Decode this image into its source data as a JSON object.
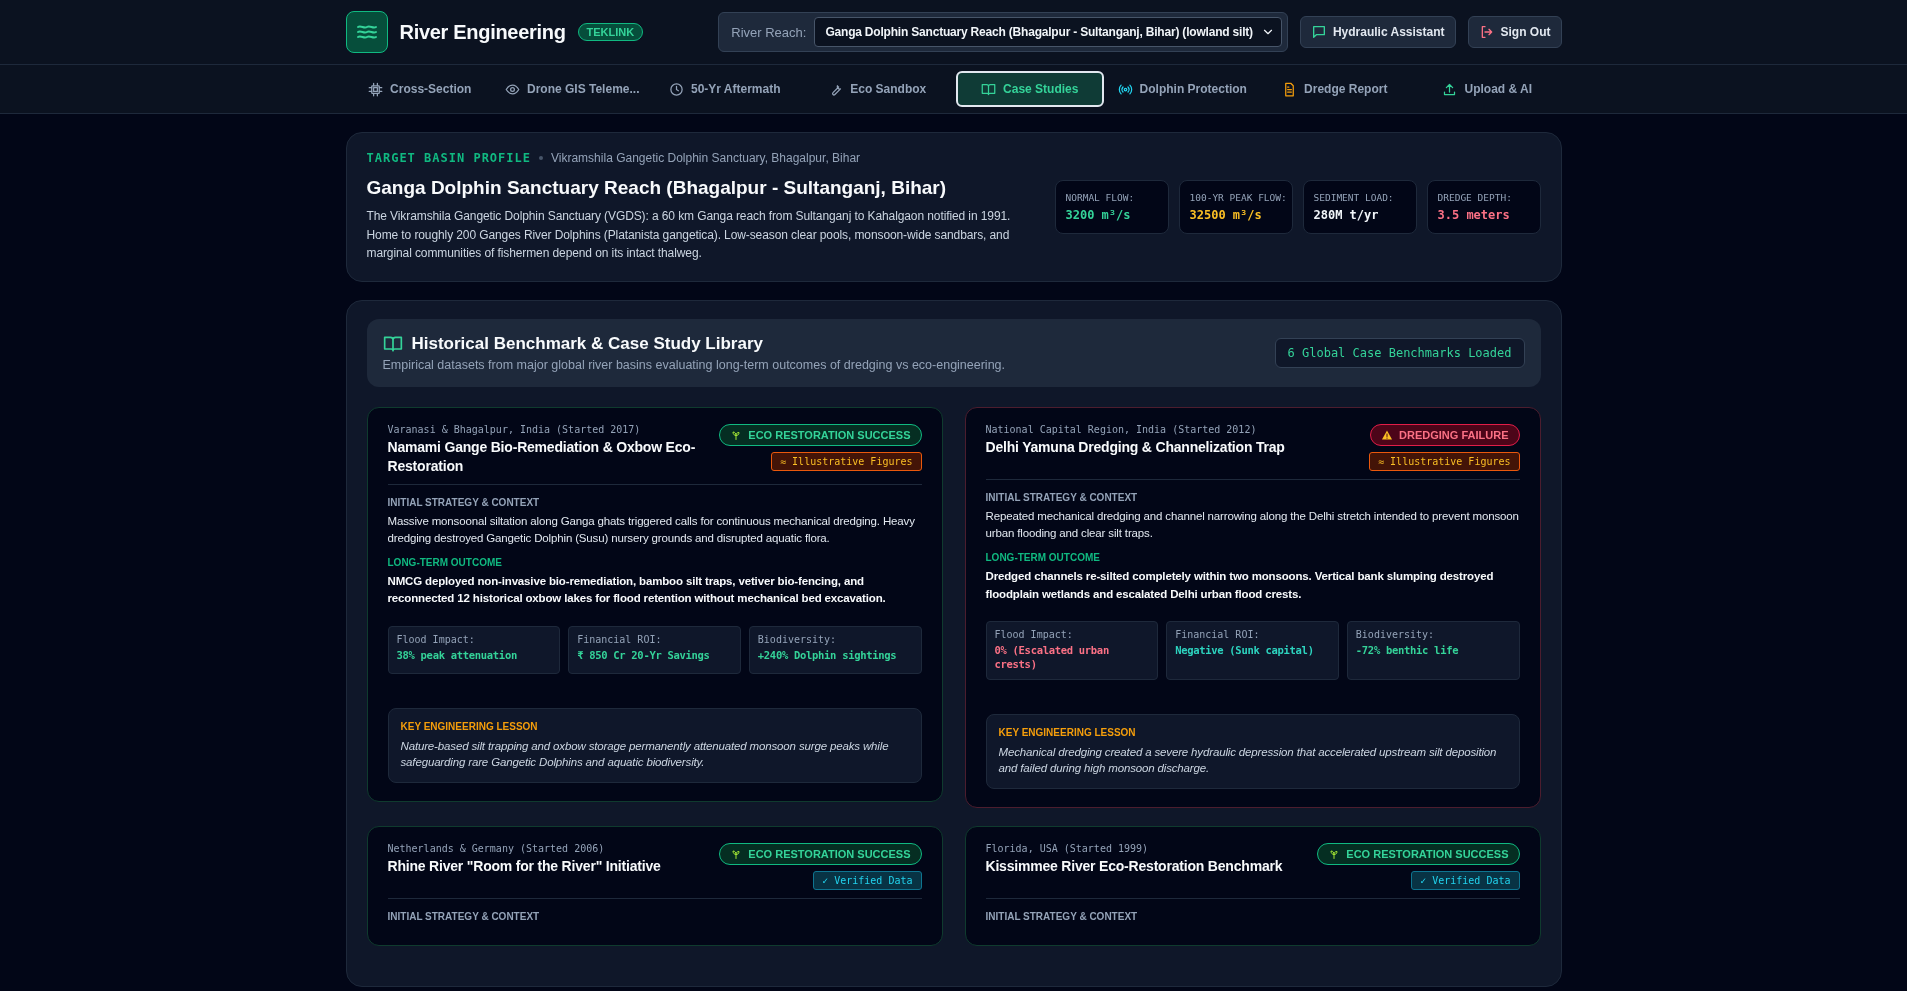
{
  "header": {
    "title": "River Engineering",
    "badge": "TEKLINK",
    "reach_label": "River Reach:",
    "reach_value": "Ganga Dolphin Sanctuary Reach (Bhagalpur - Sultanganj, Bihar) (lowland silt)",
    "buttons": [
      {
        "kind": "assistant",
        "label": "Hydraulic Assistant"
      },
      {
        "kind": "signout",
        "label": "Sign Out"
      }
    ]
  },
  "tabs": [
    {
      "label": "Cross-Section",
      "selected": false
    },
    {
      "label": "Drone GIS Teleme...",
      "selected": false
    },
    {
      "label": "50-Yr Aftermath",
      "selected": false
    },
    {
      "label": "Eco Sandbox",
      "selected": false
    },
    {
      "label": "Case Studies",
      "selected": true
    },
    {
      "label": "Dolphin Protection",
      "selected": false
    },
    {
      "label": "Dredge Report",
      "selected": false
    },
    {
      "label": "Upload & AI",
      "selected": false
    }
  ],
  "basin_profile": {
    "eyebrow": "TARGET BASIN PROFILE",
    "location": "Vikramshila Gangetic Dolphin Sanctuary, Bhagalpur, Bihar",
    "title": "Ganga Dolphin Sanctuary Reach (Bhagalpur - Sultanganj, Bihar)",
    "description": "The Vikramshila Gangetic Dolphin Sanctuary (VGDS): a 60 km Ganga reach from Sultanganj to Kahalgaon notified in 1991. Home to roughly 200 Ganges River Dolphins (Platanista gangetica). Low-season clear pools, monsoon-wide sandbars, and marginal communities of fishermen depend on its intact thalweg.",
    "stats": [
      {
        "label": "NORMAL FLOW:",
        "value": "3200 m³/s",
        "color": "#34d399"
      },
      {
        "label": "100-YR PEAK FLOW:",
        "value": "32500 m³/s",
        "color": "#fbbf24"
      },
      {
        "label": "SEDIMENT LOAD:",
        "value": "280M t/yr",
        "color": "#f1f5f9"
      },
      {
        "label": "DREDGE DEPTH:",
        "value": "3.5 meters",
        "color": "#fb7185"
      }
    ]
  },
  "library": {
    "title": "Historical Benchmark & Case Study Library",
    "subtitle": "Empirical datasets from major global river basins evaluating long-term outcomes of dredging vs eco-engineering.",
    "count_badge": "6 Global Case Benchmarks Loaded",
    "cases": [
      {
        "kind": "success",
        "location": "Varanasi & Bhagalpur, India (Started 2017)",
        "title": "Namami Gange Bio-Remediation & Oxbow Eco-Restoration",
        "status": "ECO RESTORATION SUCCESS",
        "figures": {
          "kind": "illustrative",
          "label": "≈ Illustrative Figures"
        },
        "strategy_label": "INITIAL STRATEGY & CONTEXT",
        "strategy": "Massive monsoonal siltation along Ganga ghats triggered calls for continuous mechanical dredging. Heavy dredging destroyed Gangetic Dolphin (Susu) nursery grounds and disrupted aquatic flora.",
        "outcome_label": "LONG-TERM OUTCOME",
        "outcome": "NMCG deployed non-invasive bio-remediation, bamboo silt traps, vetiver bio-fencing, and reconnected 12 historical oxbow lakes for flood retention without mechanical bed excavation.",
        "metrics": [
          {
            "label": "Flood Impact:",
            "value": "38% peak attenuation",
            "color": "#34d399"
          },
          {
            "label": "Financial ROI:",
            "value": "₹ 850 Cr 20-Yr Savings",
            "color": "#34d399"
          },
          {
            "label": "Biodiversity:",
            "value": "+240% Dolphin sightings",
            "color": "#34d399"
          }
        ],
        "lesson_label": "KEY ENGINEERING LESSON",
        "lesson": "Nature-based silt trapping and oxbow storage permanently attenuated monsoon surge peaks while safeguarding rare Gangetic Dolphins and aquatic biodiversity."
      },
      {
        "kind": "failure",
        "location": "National Capital Region, India (Started 2012)",
        "title": "Delhi Yamuna Dredging & Channelization Trap",
        "status": "DREDGING FAILURE",
        "figures": {
          "kind": "illustrative",
          "label": "≈ Illustrative Figures"
        },
        "strategy_label": "INITIAL STRATEGY & CONTEXT",
        "strategy": "Repeated mechanical dredging and channel narrowing along the Delhi stretch intended to prevent monsoon urban flooding and clear silt traps.",
        "outcome_label": "LONG-TERM OUTCOME",
        "outcome": "Dredged channels re-silted completely within two monsoons. Vertical bank slumping destroyed floodplain wetlands and escalated Delhi urban flood crests.",
        "metrics": [
          {
            "label": "Flood Impact:",
            "value": "0% (Escalated urban crests)",
            "color": "#fb7185"
          },
          {
            "label": "Financial ROI:",
            "value": "Negative (Sunk capital)",
            "color": "#2dd4bf"
          },
          {
            "label": "Biodiversity:",
            "value": "-72% benthic life",
            "color": "#34d399"
          }
        ],
        "lesson_label": "KEY ENGINEERING LESSON",
        "lesson": "Mechanical dredging created a severe hydraulic depression that accelerated upstream silt deposition and failed during high monsoon discharge."
      },
      {
        "kind": "success",
        "location": "Netherlands & Germany (Started 2006)",
        "title": "Rhine River \"Room for the River\" Initiative",
        "status": "ECO RESTORATION SUCCESS",
        "figures": {
          "kind": "verified",
          "label": "✓ Verified Data"
        },
        "strategy_label": "INITIAL STRATEGY & CONTEXT"
      },
      {
        "kind": "success",
        "location": "Florida, USA (Started 1999)",
        "title": "Kissimmee River Eco-Restoration Benchmark",
        "status": "ECO RESTORATION SUCCESS",
        "figures": {
          "kind": "verified",
          "label": "✓ Verified Data"
        },
        "strategy_label": "INITIAL STRATEGY & CONTEXT"
      }
    ]
  }
}
